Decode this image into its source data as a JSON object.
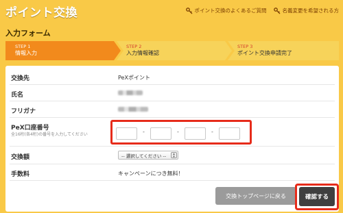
{
  "header": {
    "title": "ポイント交換",
    "links": [
      {
        "label": "ポイント交換のよくあるご質問",
        "icon": "key-icon"
      },
      {
        "label": "名義変更を希望される方",
        "icon": "key-icon"
      }
    ]
  },
  "form": {
    "section_title": "入力フォーム",
    "steps": [
      {
        "number": "STEP 1",
        "name": "情報入力",
        "state": "active"
      },
      {
        "number": "STEP 2",
        "name": "入力情報確認",
        "state": "pending"
      },
      {
        "number": "STEP 3",
        "name": "ポイント交換申請完了",
        "state": "pending"
      }
    ],
    "rows": {
      "exchange_target": {
        "label": "交換先",
        "value": "PeXポイント"
      },
      "name": {
        "label": "氏名"
      },
      "furigana": {
        "label": "フリガナ"
      },
      "pex_number": {
        "label": "PeX口座番号",
        "note": "全16桁(各4桁)の番号を入力してください",
        "separator": "-"
      },
      "amount": {
        "label": "交換額",
        "select_value": "-- 選択してください --"
      },
      "fee": {
        "label": "手数料",
        "value": "キャンペーンにつき無料！"
      }
    },
    "buttons": {
      "back": "交換トップページに戻る",
      "confirm": "確認する"
    }
  },
  "colors": {
    "background": "#f9c947",
    "step_active": "#f28a1c",
    "step_pending": "#f7d35a",
    "highlight": "#e62b1a",
    "confirm_button": "#3f3f3f",
    "back_button": "#9b9b9b"
  }
}
